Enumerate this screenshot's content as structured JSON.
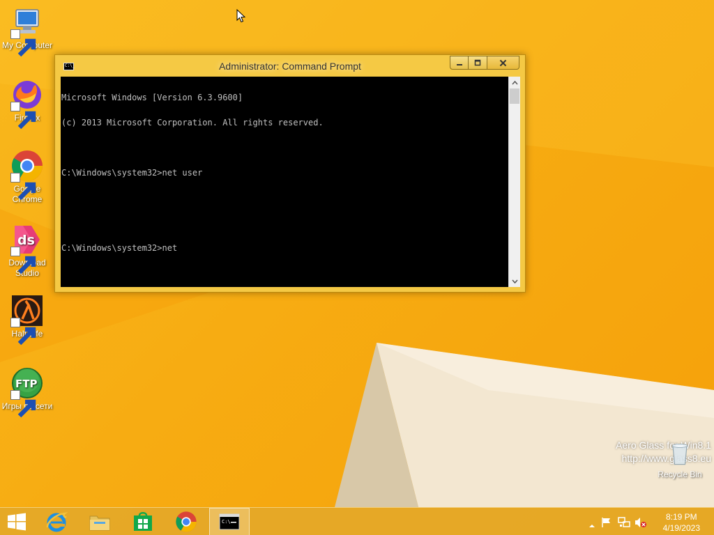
{
  "desktop": {
    "icons": [
      {
        "label": "My Computer"
      },
      {
        "label": "Firefox"
      },
      {
        "label": "Google Chrome"
      },
      {
        "label": "Download Studio"
      },
      {
        "label": "Half-Life"
      },
      {
        "label": "Игры по сети"
      },
      {
        "label": "Recycle Bin"
      }
    ],
    "watermark": {
      "line1": "Aero Glass for Win8.1",
      "line2": "http://www.glass8.eu"
    }
  },
  "cmd_window": {
    "title": "Administrator:  Command Prompt",
    "lines": [
      "Microsoft Windows [Version 6.3.9600]",
      "(c) 2013 Microsoft Corporation. All rights reserved.",
      "",
      "C:\\Windows\\system32>net user",
      "",
      "",
      "C:\\Windows\\system32>net"
    ]
  },
  "taskbar": {
    "apps": [
      {
        "name": "start-button"
      },
      {
        "name": "internet-explorer"
      },
      {
        "name": "file-explorer"
      },
      {
        "name": "windows-store"
      },
      {
        "name": "google-chrome"
      },
      {
        "name": "command-prompt",
        "active": true
      }
    ],
    "clock": {
      "time": "8:19 PM",
      "date": "4/19/2023"
    }
  },
  "colors": {
    "wallpaper": "#f7ac12",
    "window_frame": "#f5c944",
    "console_bg": "#000000",
    "console_fg": "#c0c0c0"
  }
}
